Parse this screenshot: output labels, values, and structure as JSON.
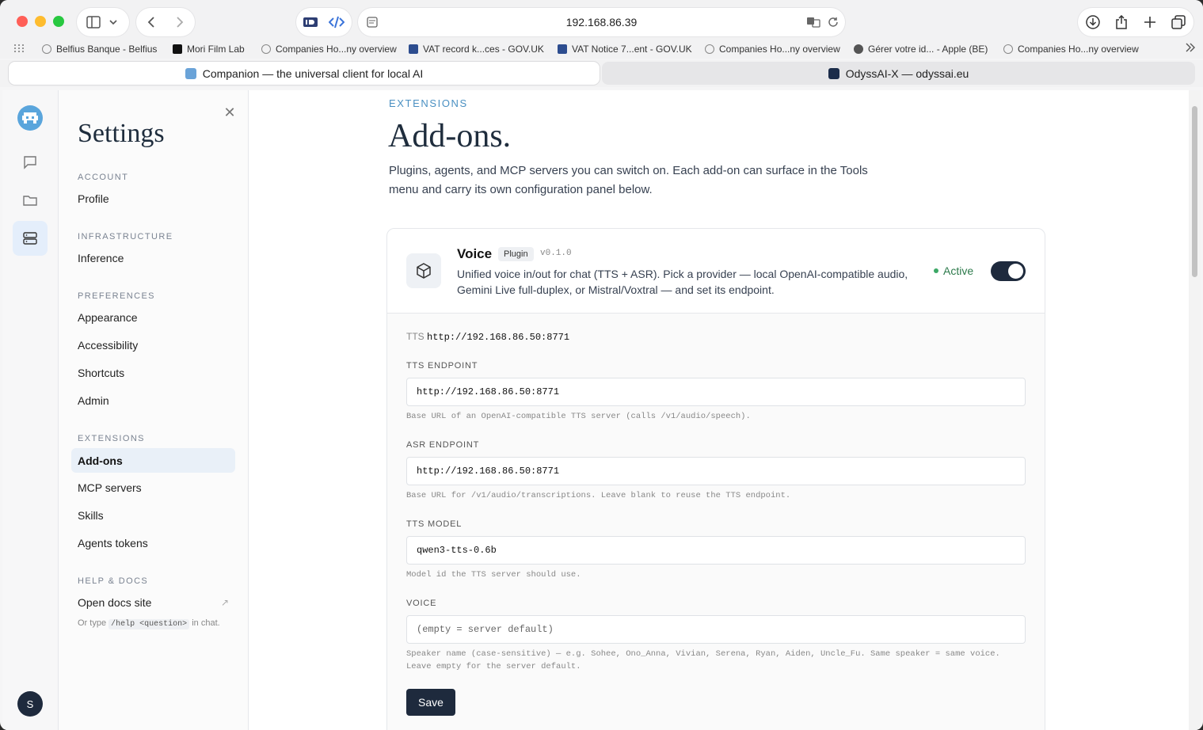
{
  "browser": {
    "address": "192.168.86.39",
    "bookmarks": [
      "Belfius Banque - Belfius",
      "Mori Film Lab",
      "Companies Ho...ny overview",
      "VAT record k...ces - GOV.UK",
      "VAT Notice 7...ent - GOV.UK",
      "Companies Ho...ny overview",
      "Gérer votre id... - Apple (BE)",
      "Companies Ho...ny overview"
    ],
    "tabs": [
      "Companion — the universal client for local AI",
      "OdyssAI-X — odyssai.eu"
    ]
  },
  "rail": {
    "avatar_initial": "S"
  },
  "settings": {
    "title": "Settings",
    "sections": {
      "account": "ACCOUNT",
      "infrastructure": "INFRASTRUCTURE",
      "preferences": "PREFERENCES",
      "extensions": "EXTENSIONS",
      "help": "HELP & DOCS"
    },
    "items": {
      "profile": "Profile",
      "inference": "Inference",
      "appearance": "Appearance",
      "accessibility": "Accessibility",
      "shortcuts": "Shortcuts",
      "admin": "Admin",
      "addons": "Add-ons",
      "mcp": "MCP servers",
      "skills": "Skills",
      "agents_tokens": "Agents tokens",
      "docs": "Open docs site"
    },
    "hint_pre": "Or type",
    "hint_code": "/help <question>",
    "hint_post": "in chat."
  },
  "main": {
    "eyebrow": "EXTENSIONS",
    "title": "Add-ons.",
    "lead": "Plugins, agents, and MCP servers you can switch on. Each add-on can surface in the Tools menu and carry its own configuration panel below."
  },
  "addon": {
    "name": "Voice",
    "badge": "Plugin",
    "version": "v0.1.0",
    "description": "Unified voice in/out for chat (TTS + ASR). Pick a provider — local OpenAI-compatible audio, Gemini Live full-duplex, or Mistral/Voxtral — and set its endpoint.",
    "status": "Active",
    "enabled": true,
    "summary_label": "TTS",
    "summary_value": "http://192.168.86.50:8771",
    "fields": {
      "tts_endpoint": {
        "label": "TTS ENDPOINT",
        "value": "http://192.168.86.50:8771",
        "help": "Base URL of an OpenAI-compatible TTS server (calls /v1/audio/speech)."
      },
      "asr_endpoint": {
        "label": "ASR ENDPOINT",
        "value": "http://192.168.86.50:8771",
        "help": "Base URL for /v1/audio/transcriptions. Leave blank to reuse the TTS endpoint."
      },
      "tts_model": {
        "label": "TTS MODEL",
        "value": "qwen3-tts-0.6b",
        "help": "Model id the TTS server should use."
      },
      "voice": {
        "label": "VOICE",
        "placeholder": "(empty = server default)",
        "help": "Speaker name (case-sensitive) — e.g. Sohee, Ono_Anna, Vivian, Serena, Ryan, Aiden, Uncle_Fu. Same speaker = same voice. Leave empty for the server default."
      }
    },
    "save_label": "Save"
  }
}
